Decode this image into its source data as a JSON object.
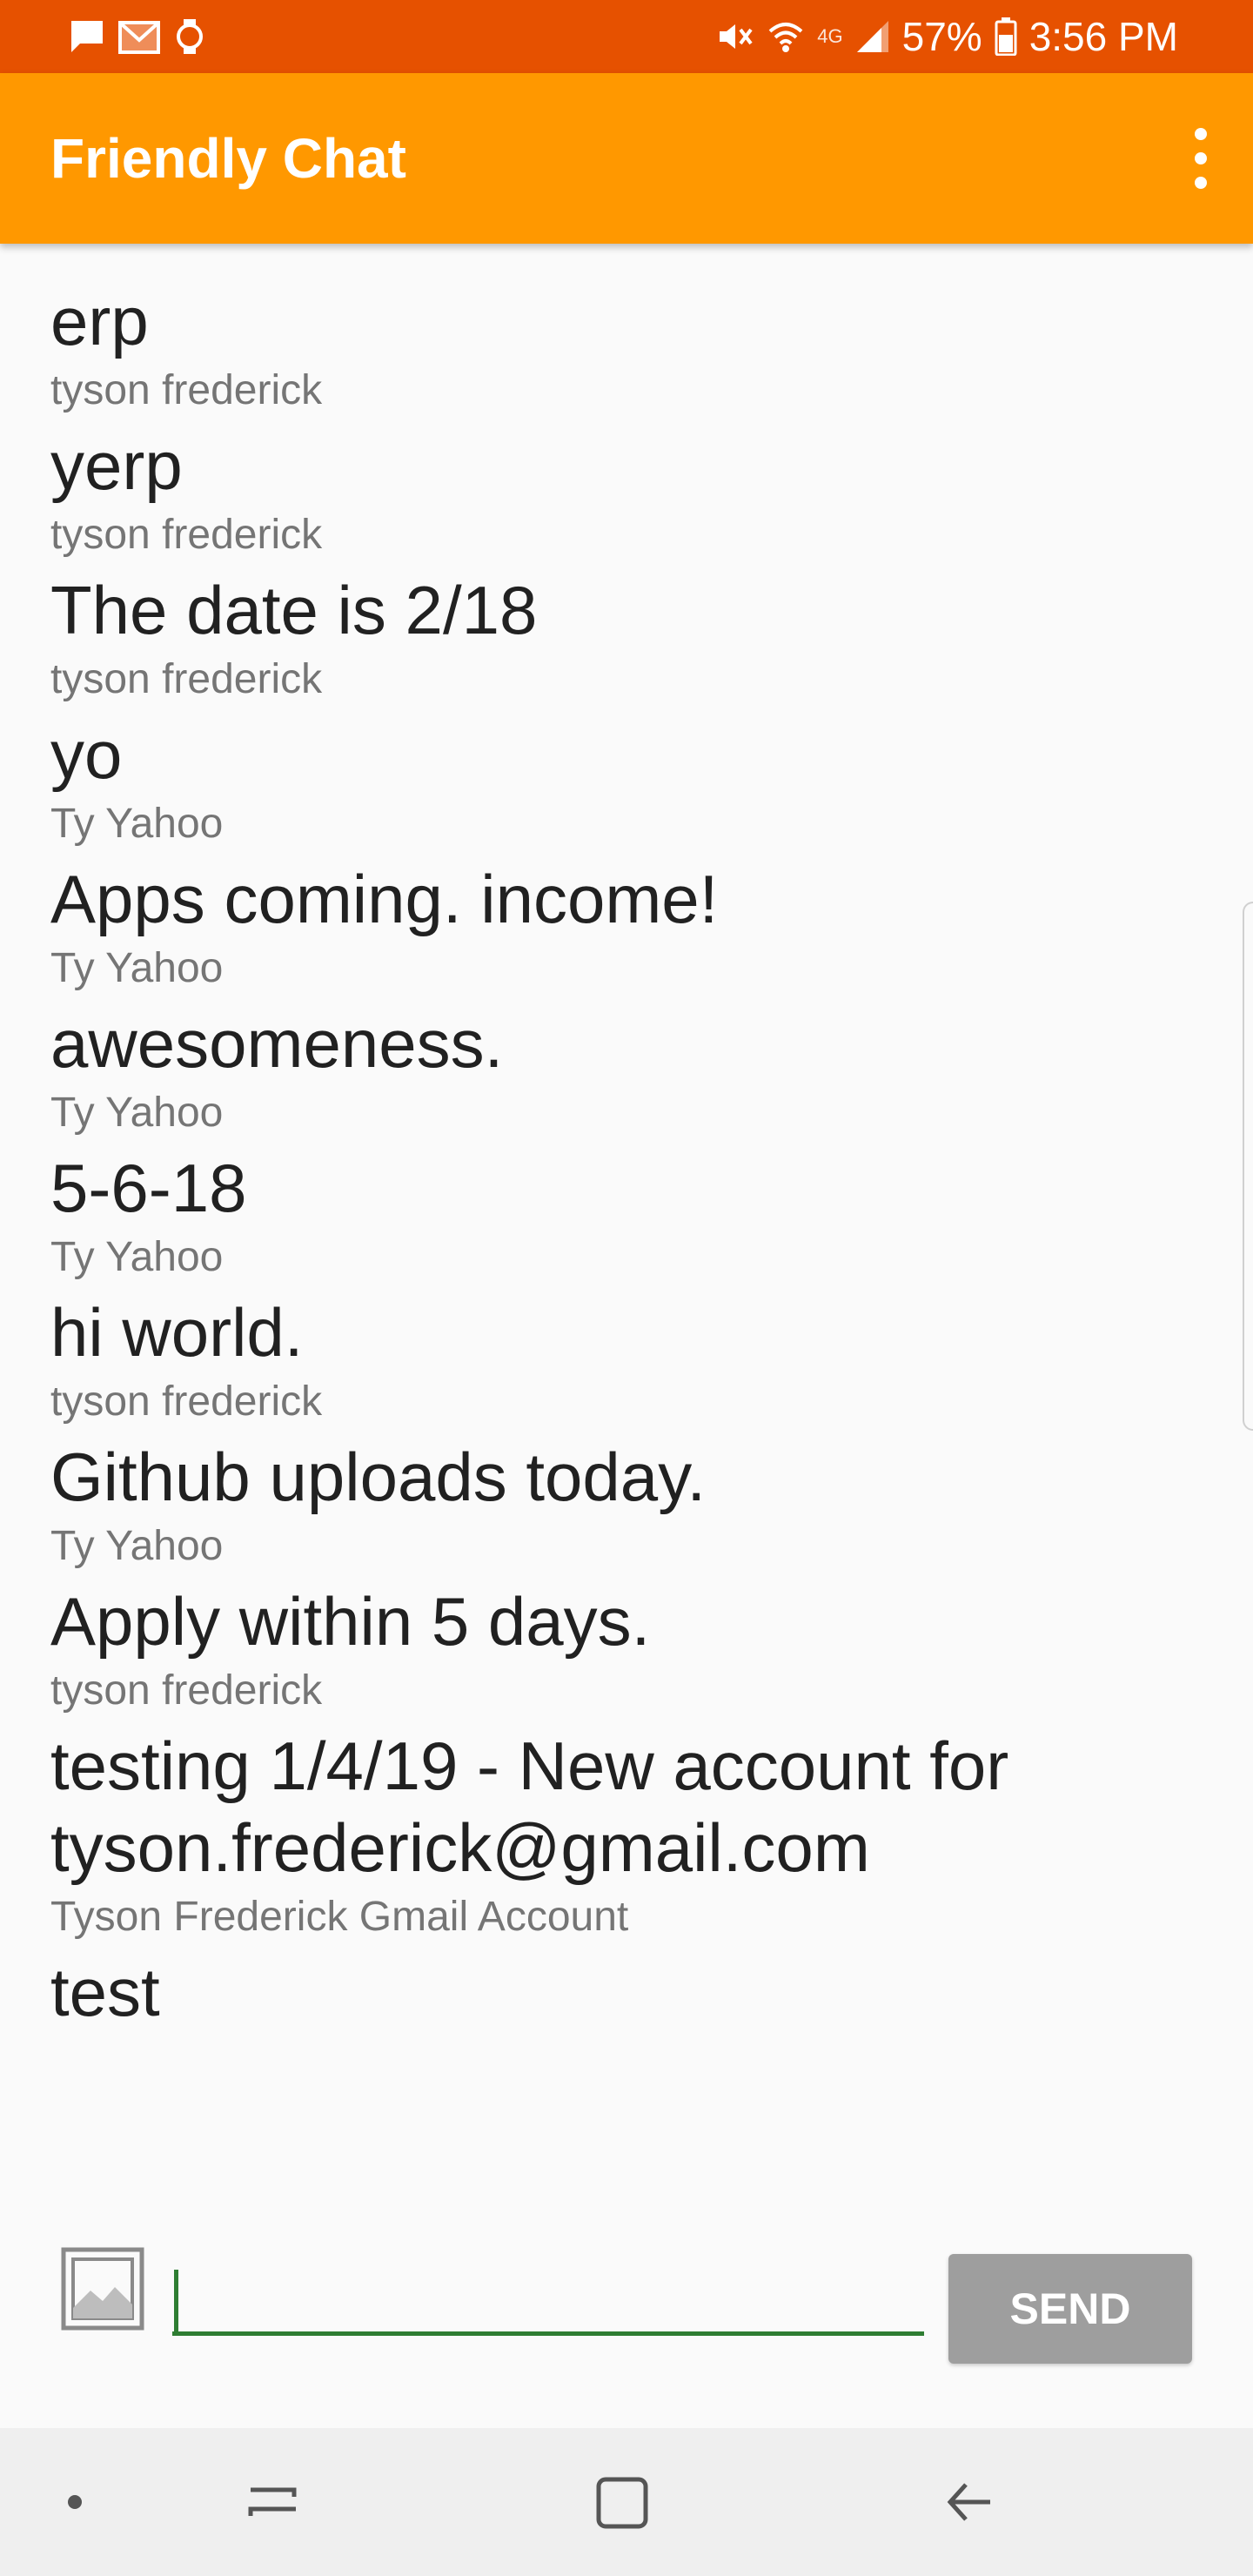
{
  "status_bar": {
    "battery_percent": "57%",
    "network": "4G",
    "time": "3:56 PM"
  },
  "app_bar": {
    "title": "Friendly Chat"
  },
  "messages": [
    {
      "text": "erp",
      "author": "tyson frederick"
    },
    {
      "text": "yerp",
      "author": "tyson frederick"
    },
    {
      "text": "The date is 2/18",
      "author": "tyson frederick"
    },
    {
      "text": "yo",
      "author": "Ty Yahoo"
    },
    {
      "text": "Apps coming. income!",
      "author": "Ty Yahoo"
    },
    {
      "text": "awesomeness.",
      "author": "Ty Yahoo"
    },
    {
      "text": "5-6-18",
      "author": "Ty Yahoo"
    },
    {
      "text": "hi world.",
      "author": "tyson frederick"
    },
    {
      "text": "Github uploads today.",
      "author": "Ty Yahoo"
    },
    {
      "text": "Apply within 5 days.",
      "author": "tyson frederick"
    },
    {
      "text": "testing 1/4/19 - New account for tyson.frederick@gmail.com",
      "author": "Tyson Frederick Gmail Account"
    },
    {
      "text": "test",
      "author": ""
    }
  ],
  "composer": {
    "input_value": "",
    "send_label": "SEND"
  },
  "colors": {
    "status_bar": "#e65100",
    "app_bar": "#ff9800",
    "input_underline": "#2e7d32",
    "send_button": "#9e9e9e"
  }
}
